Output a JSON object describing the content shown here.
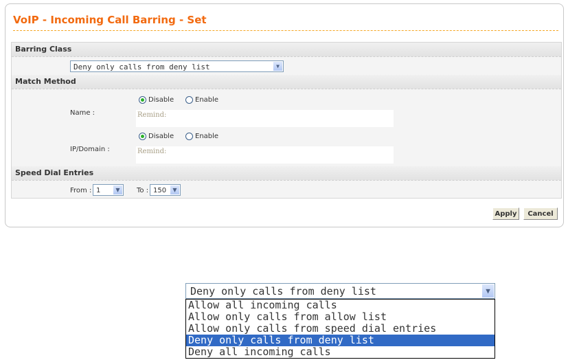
{
  "title": "VoIP - Incoming Call Barring - Set",
  "barring_class": {
    "header": "Barring Class",
    "selected": "Deny only calls from deny list"
  },
  "match_method": {
    "header": "Match Method",
    "name": {
      "label": "Name :",
      "disable": "Disable",
      "enable": "Enable",
      "selected": "Disable",
      "remind": "Remind:"
    },
    "ip_domain": {
      "label": "IP/Domain :",
      "disable": "Disable",
      "enable": "Enable",
      "selected": "Disable",
      "remind": "Remind:"
    }
  },
  "speed_dial": {
    "header": "Speed Dial Entries",
    "from_label": "From :",
    "from_value": "1",
    "to_label": "To :",
    "to_value": "150"
  },
  "buttons": {
    "apply": "Apply",
    "cancel": "Cancel"
  },
  "dropdown": {
    "selected": "Deny only calls from deny list",
    "options": [
      "Allow all incoming calls",
      "Allow only calls from allow list",
      "Allow only calls from speed dial entries",
      "Deny only calls from deny list",
      "Deny all incoming calls"
    ],
    "highlighted_index": 3
  },
  "colors": {
    "title": "#f26a10",
    "highlight": "#316ac5"
  }
}
